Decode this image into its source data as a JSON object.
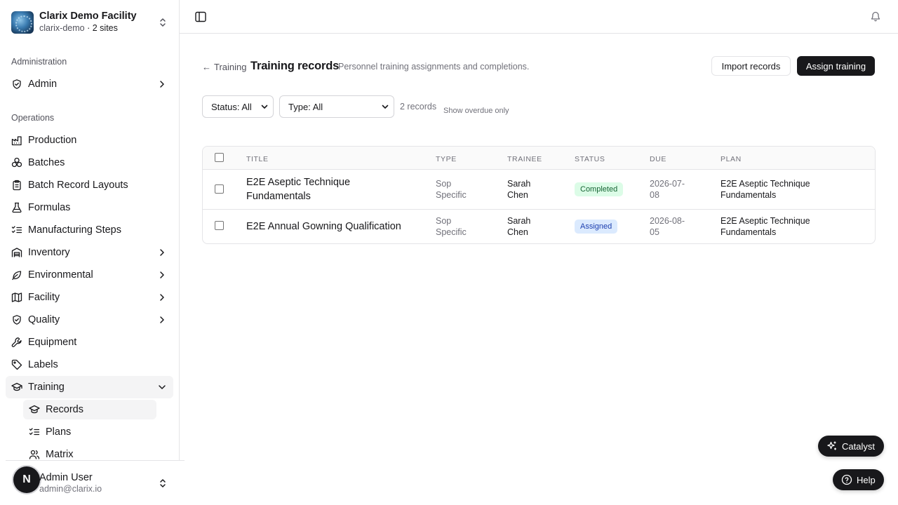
{
  "org": {
    "name": "Clarix Demo Facility",
    "slug": "clarix-demo",
    "sites": "2 sites",
    "separator": "·"
  },
  "sections": {
    "administration": "Administration",
    "operations": "Operations"
  },
  "nav": {
    "admin": "Admin",
    "production": "Production",
    "batches": "Batches",
    "batch_record_layouts": "Batch Record Layouts",
    "formulas": "Formulas",
    "manufacturing_steps": "Manufacturing Steps",
    "inventory": "Inventory",
    "environmental": "Environmental",
    "facility": "Facility",
    "quality": "Quality",
    "equipment": "Equipment",
    "labels": "Labels",
    "training": "Training",
    "training_sub": {
      "records": "Records",
      "plans": "Plans",
      "matrix": "Matrix"
    }
  },
  "user": {
    "initial": "N",
    "name": "Admin User",
    "email": "admin@clarix.io"
  },
  "page": {
    "back_label": "Training",
    "title": "Training records",
    "description": "Personnel training assignments and completions.",
    "import_button": "Import records",
    "assign_button": "Assign training"
  },
  "filters": {
    "status": "Status: All",
    "type": "Type: All",
    "record_count": "2 records",
    "overdue_label": "Show overdue only"
  },
  "table": {
    "headers": {
      "title": "Title",
      "type": "Type",
      "trainee": "Trainee",
      "status": "Status",
      "due": "Due",
      "plan": "Plan"
    },
    "rows": [
      {
        "title_line1": "E2E Aseptic Technique",
        "title_line2": "Fundamentals",
        "type_line1": "Sop",
        "type_line2": "Specific",
        "trainee_line1": "Sarah",
        "trainee_line2": "Chen",
        "status": "Completed",
        "due_line1": "2026-07-",
        "due_line2": "08",
        "plan_line1": "E2E Aseptic Technique",
        "plan_line2": "Fundamentals"
      },
      {
        "title_line1": "E2E Annual Gowning Qualification",
        "type_line1": "Sop",
        "type_line2": "Specific",
        "trainee_line1": "Sarah",
        "trainee_line2": "Chen",
        "status": "Assigned",
        "due_line1": "2026-08-",
        "due_line2": "05",
        "plan_line1": "E2E Aseptic Technique",
        "plan_line2": "Fundamentals"
      }
    ]
  },
  "floating": {
    "catalyst": "Catalyst",
    "help": "Help"
  },
  "colors": {
    "primary": "#18181b",
    "completed_bg": "#dcfce7",
    "completed_fg": "#166534",
    "assigned_bg": "#dbeafe",
    "assigned_fg": "#1e40af"
  }
}
